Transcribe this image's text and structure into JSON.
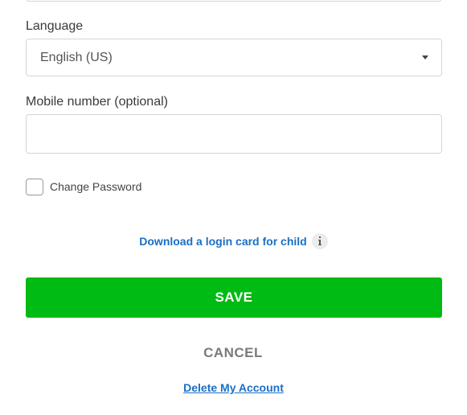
{
  "language": {
    "label": "Language",
    "selected": "English (US)"
  },
  "mobile": {
    "label": "Mobile number (optional)",
    "value": "",
    "placeholder": ""
  },
  "change_password": {
    "label": "Change Password",
    "checked": false
  },
  "login_card": {
    "link_text": "Download a login card for child"
  },
  "actions": {
    "save_label": "SAVE",
    "cancel_label": "CANCEL",
    "delete_label": "Delete My Account"
  },
  "colors": {
    "save": "#00bb13",
    "link": "#1a6fc4",
    "cancel_text": "#7a7a7a"
  }
}
